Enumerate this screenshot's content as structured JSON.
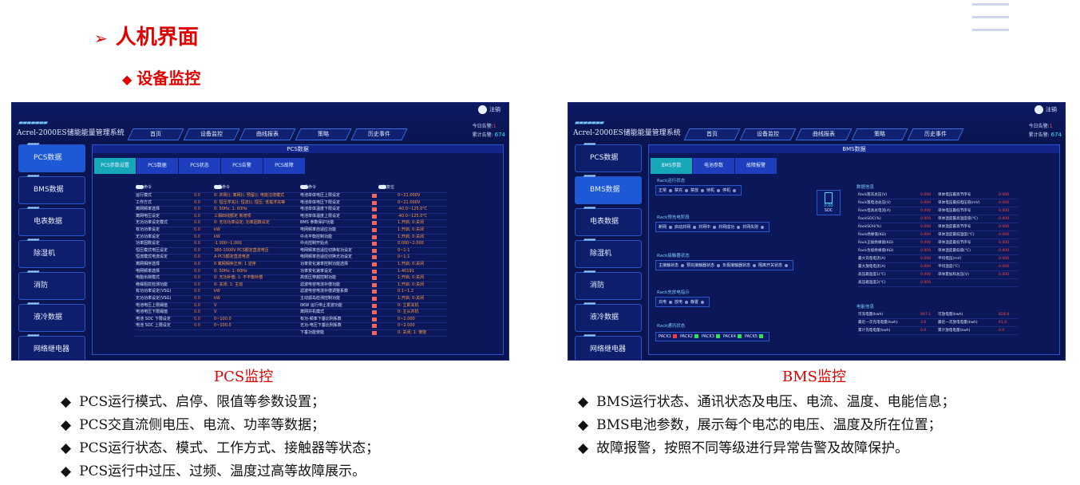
{
  "heading": {
    "arrow": "➢",
    "title": "人机界面"
  },
  "subheading": {
    "marker": "◆",
    "title": "设备监控"
  },
  "colors": {
    "accent_red": "#e00000",
    "hmi_bg": "#0a1450",
    "hmi_active": "#1d58d6"
  },
  "hmi_common": {
    "app_title": "Acrel-2000ES储能能量管理系统",
    "user": "注销",
    "stats": {
      "today_label": "今日告警:",
      "today_value": "1",
      "total_label": "累计告警:",
      "total_value": "674"
    },
    "nav": [
      "首页",
      "设备监控",
      "曲线报表",
      "策略",
      "历史事件"
    ],
    "side": [
      "PCS数据",
      "BMS数据",
      "电表数据",
      "除湿机",
      "消防",
      "液冷数据",
      "网络继电器"
    ]
  },
  "pcs": {
    "panel_title": "PCS数据",
    "tabs": [
      "PCS参数设置",
      "PCS数据",
      "PCS状态",
      "PCS告警",
      "PCS故障"
    ],
    "header": [
      "启动命令",
      "停机命令",
      "待机命令",
      "故障复位"
    ],
    "rows": [
      [
        "运行模式",
        "0.0",
        "0: 并网(); 离网(); 预留(); 电能注增模式",
        "电池单体电压上限设定",
        "0~21.000V"
      ],
      [
        "工作方式",
        "0.0",
        "0: 恒压浮充(); 恒流(); 恒压; 低载浮充等",
        "电池单体电压下限设定",
        "0~21.000V"
      ],
      [
        "离网频率选择",
        "0.0",
        "0: 50Hz; 1: 60Hz",
        "电池单体温度下限设定",
        "-40.0~125.0℃"
      ],
      [
        "离网电压设定",
        "0.0",
        "三相四线额定 新增项",
        "电池单体温度上限设定",
        "-40.0~125.0℃"
      ],
      [
        "无功功率设定模式",
        "0.0",
        "0: 无功功率设定; 功率因数设定",
        "BMS 参数保护功能",
        "1:开启; 0:关闭"
      ],
      [
        "有功功率设定",
        "0.0",
        "kW",
        "电网频率自适应功能",
        "1:开启; 0:关闭"
      ],
      [
        "无功功率设定",
        "0.0",
        "kW",
        "中点平衡控制功能",
        "1:开启; 0:关闭"
      ],
      [
        "功率因数设定",
        "0.0",
        "-1.000~1.000",
        "中点控制开始点",
        "0.000~2.000"
      ],
      [
        "恒压模式电压设定",
        "0.0",
        "380-1000V PCS额定直流电压",
        "电网频率自适应切换有功设定",
        "0~1:1"
      ],
      [
        "恒流模式电流设定",
        "0.0",
        "A  PCS额定直流电流",
        "电网频率自适应切换无功设定",
        "0~1:1"
      ],
      [
        "离网相序选择",
        "0.0",
        "0 离网相序正序; 1 逆序",
        "功率变化速率控制功能选择",
        "1:开启; 0:关闭"
      ],
      [
        "电网频率选择",
        "0.0",
        "0: 50Hz; 1: 60Hz",
        "功率变化速率设定",
        "1-40191"
      ],
      [
        "电能出荷模式",
        "0.0",
        "0: 无功补偿; 1: 不平衡补偿",
        "高低压穿越控制功能",
        "1:开启; 0:关闭"
      ],
      [
        "绝缘阻抗检测功能",
        "0.0",
        "0: 关闭; 1: 主动",
        "滤波电容电流补偿功能",
        "1:开启; 0:关闭"
      ],
      [
        "有功功率设定(VSG)",
        "0.0",
        "kW",
        "滤波电容电流补偿调整系数",
        "0.1~1.2"
      ],
      [
        "无功功率设定(VSG)",
        "0.0",
        "kW",
        "主动孤岛检测控制功能",
        "1:开启; 0:关闭"
      ],
      [
        "电池电压上限阈值",
        "0.0",
        "V",
        "0KW 运行停止发波功能",
        "0: 立即关机"
      ],
      [
        "电池电压下限阈值",
        "0.0",
        "V",
        "离网并机模式",
        "0: 主从并机"
      ],
      [
        "电池 SOC 下限设定",
        "0.0",
        "0~100.0",
        "有功-频率下垂比例系数",
        "0~2.000"
      ],
      [
        "电池 SOC 上限设定",
        "0.0",
        "0~100.0",
        "无功-电压下垂比例系数",
        "0~2.000"
      ],
      [
        "",
        "",
        "",
        "下垂功能使能",
        "0: 关闭; 1: 使能"
      ]
    ]
  },
  "bms": {
    "panel_title": "BMS数据",
    "tabs": [
      "BMS参数",
      "电池参数",
      "故障报警"
    ],
    "run_title": "Rack运行状态",
    "run_items": [
      "正常",
      "禁充",
      "禁放",
      "待机",
      "停机"
    ],
    "soc_label": "SOC",
    "soc_value": "0.00",
    "precharge_title": "Rack预充电阶段",
    "precharge_items": [
      "断网",
      "启动并网",
      "并网中",
      "并网成功",
      "并网失败"
    ],
    "contactor_title": "Rack接触器状态",
    "contactor_items": [
      "主接触状态",
      "预充接触器状态",
      "负极接触器状态",
      "隔离开关状态"
    ],
    "charge_title": "Rack充放电指示",
    "charge_items": [
      "充电",
      "放电",
      "静置"
    ],
    "comm_title": "Rack通讯状态",
    "comm_items": [
      "PACK1",
      "PACK2",
      "PACK3",
      "PACK4",
      "PACK5"
    ],
    "data_title": "数据信息",
    "data_rows": [
      [
        "Rack簇充总压(V)",
        "0.000",
        "单体电压最高节序号",
        "0.000"
      ],
      [
        "Rack簇电池总压(V)",
        "0.000",
        "单体电压最低电压值(mV)",
        "0.000"
      ],
      [
        "Rack电池总电流(A)",
        "0.000",
        "单体电压最低节序号",
        "0.000"
      ],
      [
        "RackSOC(%)",
        "0.000",
        "单体温度最高温度值(℃)",
        "0.000"
      ],
      [
        "RackSOH(%)",
        "0.000",
        "单体温度最高节序号",
        "0.000"
      ],
      [
        "Rack绝缘值(KΩ)",
        "0.000",
        "单体温度最低温度(℃)",
        "0.000"
      ],
      [
        "Rack正极绝缘值(KΩ)",
        "0.000",
        "单体温度最低节序号",
        "0.000"
      ],
      [
        "Rack负极绝缘值(KΩ)",
        "0.000",
        "单体温度最低值(℃)",
        "0.000"
      ],
      [
        "最大充电电流(A)",
        "0.000",
        "平均电压(mV)",
        "0.000"
      ],
      [
        "最大放电电流(A)",
        "0.000",
        "平均温度(℃)",
        "0.000"
      ],
      [
        "高压箱温度1(℃)",
        "0.000",
        "单体累加和总压(V)",
        "0.000"
      ],
      [
        "高压箱温度2(℃)",
        "0.000",
        "",
        ""
      ]
    ],
    "energy_title": "电能信息",
    "energy_rows": [
      [
        "可充电量(kwh)",
        "897.1",
        "可放电量(kwh)",
        "828.8"
      ],
      [
        "最近一次充电电量(kwh)",
        "3.6",
        "最近一次放电电量(kwh)",
        "61.0"
      ],
      [
        "累计充电电量(kwh)",
        "0.0",
        "累计放电电量(kwh)",
        "0.0"
      ]
    ]
  },
  "captions": {
    "pcs": "PCS监控",
    "bms": "BMS监控"
  },
  "pcs_bullets": [
    "PCS运行模式、启停、限值等参数设置；",
    "PCS交直流侧电压、电流、功率等数据；",
    "PCS运行状态、模式、工作方式、接触器等状态；",
    "PCS运行中过压、过频、温度过高等故障展示。"
  ],
  "bms_bullets": [
    "BMS运行状态、通讯状态及电压、电流、温度、电能信息；",
    "BMS电池参数，展示每个电芯的电压、温度及所在位置；",
    "故障报警，按照不同等级进行异常告警及故障保护。"
  ],
  "bullet_marker": "◆"
}
